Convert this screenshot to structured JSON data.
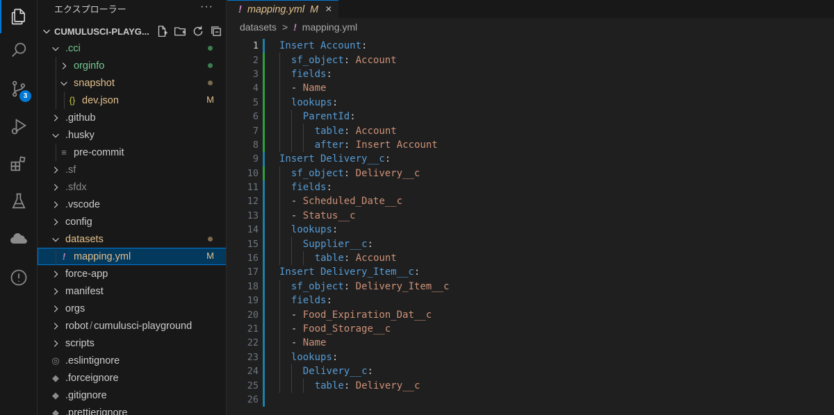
{
  "sidebar": {
    "title": "エクスプローラー",
    "more_label": "···",
    "section_title": "CUMULUSCI-PLAYG...",
    "tree": [
      {
        "name": ".cci",
        "type": "folder",
        "open": true,
        "depth": 1,
        "color": "#73c991",
        "status": "dot-green"
      },
      {
        "name": "orginfo",
        "type": "folder",
        "open": false,
        "depth": 2,
        "color": "#73c991",
        "status": "dot-green"
      },
      {
        "name": "snapshot",
        "type": "folder",
        "open": true,
        "depth": 2,
        "color": "#e2c08d",
        "status": "dot-gray"
      },
      {
        "name": "dev.json",
        "type": "json",
        "depth": 3,
        "color": "#e2c08d",
        "status": "M",
        "icon": "{}"
      },
      {
        "name": ".github",
        "type": "folder",
        "open": false,
        "depth": 1,
        "color": "#cccccc"
      },
      {
        "name": ".husky",
        "type": "folder",
        "open": true,
        "depth": 1,
        "color": "#cccccc"
      },
      {
        "name": "pre-commit",
        "type": "file",
        "depth": 2,
        "color": "#cccccc",
        "icon": "≡"
      },
      {
        "name": ".sf",
        "type": "folder",
        "open": false,
        "depth": 1,
        "color": "#8b8b8b"
      },
      {
        "name": ".sfdx",
        "type": "folder",
        "open": false,
        "depth": 1,
        "color": "#8b8b8b"
      },
      {
        "name": ".vscode",
        "type": "folder",
        "open": false,
        "depth": 1,
        "color": "#cccccc"
      },
      {
        "name": "config",
        "type": "folder",
        "open": false,
        "depth": 1,
        "color": "#cccccc"
      },
      {
        "name": "datasets",
        "type": "folder",
        "open": true,
        "depth": 1,
        "color": "#e2c08d",
        "status": "dot-gray"
      },
      {
        "name": "mapping.yml",
        "type": "yaml",
        "depth": 2,
        "color": "#e2c08d",
        "status": "M",
        "icon": "!",
        "selected": true
      },
      {
        "name": "force-app",
        "type": "folder",
        "open": false,
        "depth": 1,
        "color": "#cccccc"
      },
      {
        "name": "manifest",
        "type": "folder",
        "open": false,
        "depth": 1,
        "color": "#cccccc"
      },
      {
        "name": "orgs",
        "type": "folder",
        "open": false,
        "depth": 1,
        "color": "#cccccc"
      },
      {
        "name": "robot",
        "type": "folder",
        "open": false,
        "depth": 1,
        "color": "#cccccc",
        "suffix": "cumulusci-playground"
      },
      {
        "name": "scripts",
        "type": "folder",
        "open": false,
        "depth": 1,
        "color": "#cccccc"
      },
      {
        "name": ".eslintignore",
        "type": "file",
        "depth": 1,
        "color": "#cccccc",
        "icon": "◎"
      },
      {
        "name": ".forceignore",
        "type": "file",
        "depth": 1,
        "color": "#cccccc",
        "icon": "◆"
      },
      {
        "name": ".gitignore",
        "type": "file",
        "depth": 1,
        "color": "#cccccc",
        "icon": "◆"
      },
      {
        "name": ".prettierignore",
        "type": "file",
        "depth": 1,
        "color": "#cccccc",
        "icon": "◆"
      }
    ]
  },
  "activity": {
    "scm_badge": "3"
  },
  "editor": {
    "tab": {
      "icon": "!",
      "label": "mapping.yml",
      "status": "M",
      "close": "×"
    },
    "breadcrumb": {
      "folder": "datasets",
      "sep": ">",
      "icon": "!",
      "file": "mapping.yml"
    },
    "current_line": 1,
    "lines": [
      {
        "n": "1",
        "indent": 0,
        "key": "Insert Account",
        "colon": ":",
        "val": "",
        "gutter": "modified"
      },
      {
        "n": "2",
        "indent": 1,
        "key": "sf_object",
        "colon": ": ",
        "val": "Account",
        "gutter": "added"
      },
      {
        "n": "3",
        "indent": 1,
        "key": "fields",
        "colon": ":",
        "val": "",
        "gutter": "added"
      },
      {
        "n": "4",
        "indent": 1,
        "dash": true,
        "key": "",
        "colon": "",
        "val": "Name",
        "gutter": "added"
      },
      {
        "n": "5",
        "indent": 1,
        "key": "lookups",
        "colon": ":",
        "val": "",
        "gutter": "added"
      },
      {
        "n": "6",
        "indent": 2,
        "key": "ParentId",
        "colon": ":",
        "val": "",
        "gutter": "added"
      },
      {
        "n": "7",
        "indent": 3,
        "key": "table",
        "colon": ": ",
        "val": "Account",
        "gutter": "added"
      },
      {
        "n": "8",
        "indent": 3,
        "key": "after",
        "colon": ": ",
        "val": "Insert Account",
        "gutter": "added"
      },
      {
        "n": "9",
        "indent": 0,
        "key": "Insert Delivery__c",
        "colon": ":",
        "val": "",
        "gutter": "modified"
      },
      {
        "n": "10",
        "indent": 1,
        "key": "sf_object",
        "colon": ": ",
        "val": "Delivery__c",
        "gutter": "added"
      },
      {
        "n": "11",
        "indent": 1,
        "key": "fields",
        "colon": ":",
        "val": "",
        "gutter": "modified"
      },
      {
        "n": "12",
        "indent": 1,
        "dash": true,
        "key": "",
        "colon": "",
        "val": "Scheduled_Date__c",
        "gutter": "modified"
      },
      {
        "n": "13",
        "indent": 1,
        "dash": true,
        "key": "",
        "colon": "",
        "val": "Status__c",
        "gutter": "modified"
      },
      {
        "n": "14",
        "indent": 1,
        "key": "lookups",
        "colon": ":",
        "val": "",
        "gutter": "modified"
      },
      {
        "n": "15",
        "indent": 2,
        "key": "Supplier__c",
        "colon": ":",
        "val": "",
        "gutter": "modified"
      },
      {
        "n": "16",
        "indent": 3,
        "key": "table",
        "colon": ": ",
        "val": "Account",
        "gutter": "modified"
      },
      {
        "n": "17",
        "indent": 0,
        "key": "Insert Delivery_Item__c",
        "colon": ":",
        "val": "",
        "gutter": "modified"
      },
      {
        "n": "18",
        "indent": 1,
        "key": "sf_object",
        "colon": ": ",
        "val": "Delivery_Item__c",
        "gutter": "modified"
      },
      {
        "n": "19",
        "indent": 1,
        "key": "fields",
        "colon": ":",
        "val": "",
        "gutter": "modified"
      },
      {
        "n": "20",
        "indent": 1,
        "dash": true,
        "key": "",
        "colon": "",
        "val": "Food_Expiration_Dat__c",
        "gutter": "modified"
      },
      {
        "n": "21",
        "indent": 1,
        "dash": true,
        "key": "",
        "colon": "",
        "val": "Food_Storage__c",
        "gutter": "modified"
      },
      {
        "n": "22",
        "indent": 1,
        "dash": true,
        "key": "",
        "colon": "",
        "val": "Name",
        "gutter": "modified"
      },
      {
        "n": "23",
        "indent": 1,
        "key": "lookups",
        "colon": ":",
        "val": "",
        "gutter": "modified"
      },
      {
        "n": "24",
        "indent": 2,
        "key": "Delivery__c",
        "colon": ":",
        "val": "",
        "gutter": "modified"
      },
      {
        "n": "25",
        "indent": 3,
        "key": "table",
        "colon": ": ",
        "val": "Delivery__c",
        "gutter": "modified"
      },
      {
        "n": "26",
        "indent": 0,
        "key": "",
        "colon": "",
        "val": "",
        "gutter": "modified"
      }
    ]
  }
}
